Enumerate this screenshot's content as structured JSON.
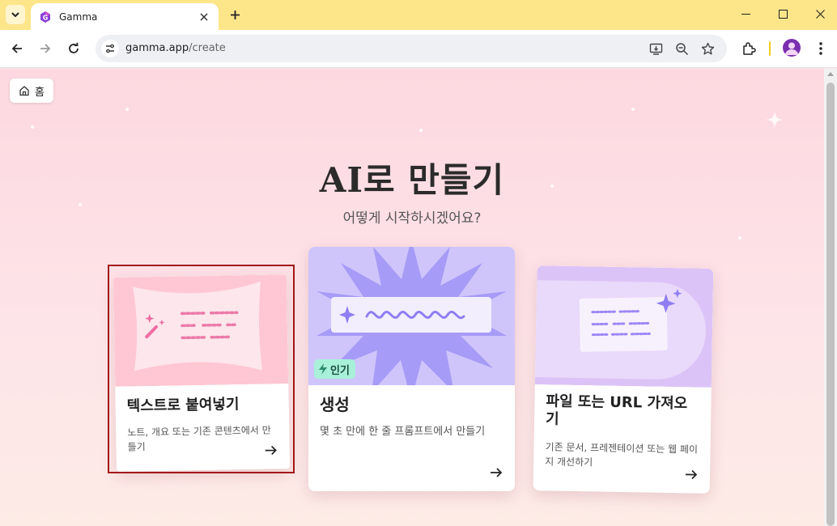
{
  "browser": {
    "tab_title": "Gamma",
    "url_host": "gamma.app",
    "url_path": "/create"
  },
  "page": {
    "home_label": "홈",
    "heading": "AI로 만들기",
    "subheading": "어떻게 시작하시겠어요?",
    "cards": [
      {
        "title": "텍스트로 붙여넣기",
        "description": "노트, 개요 또는 기존 콘텐츠에서 만들기"
      },
      {
        "title": "생성",
        "description": "몇 초 만에 한 줄 프롬프트에서 만들기",
        "badge": "인기"
      },
      {
        "title": "파일 또는 URL 가져오기",
        "description": "기존 문서, 프레젠테이션 또는 웹 페이지 개선하기"
      }
    ]
  },
  "colors": {
    "tab_strip": "#fde58a",
    "page_bg": "#fde3e8",
    "selection_outline": "#a31818",
    "badge_bg": "#a9f0d9",
    "accent_purple": "#9b87f5"
  }
}
